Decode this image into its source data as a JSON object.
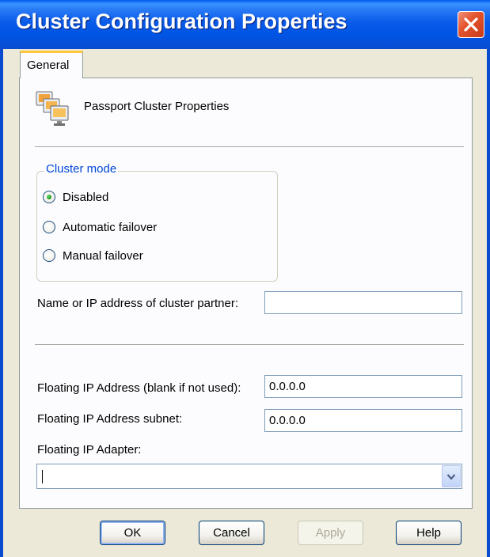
{
  "window": {
    "title": "Cluster Configuration Properties",
    "close_icon": "close-icon"
  },
  "tabs": [
    {
      "label": "General",
      "selected": true
    }
  ],
  "panel": {
    "icon": "cluster-computers-icon",
    "heading": "Passport Cluster Properties"
  },
  "cluster_mode": {
    "title": "Cluster mode",
    "options": [
      {
        "label": "Disabled",
        "checked": true
      },
      {
        "label": "Automatic failover",
        "checked": false
      },
      {
        "label": "Manual failover",
        "checked": false
      }
    ]
  },
  "fields": {
    "cluster_partner": {
      "label": "Name or IP address of cluster partner:",
      "value": ""
    },
    "floating_ip": {
      "label": "Floating IP Address (blank if not used):",
      "value": "0.0.0.0"
    },
    "floating_subnet": {
      "label": "Floating IP Address subnet:",
      "value": "0.0.0.0"
    },
    "floating_adapter": {
      "label": "Floating IP Adapter:",
      "value": ""
    }
  },
  "buttons": {
    "ok": "OK",
    "cancel": "Cancel",
    "apply": "Apply",
    "help": "Help"
  },
  "colors": {
    "titlebar": "#0055E5",
    "close_button": "#E5542F",
    "group_title": "#0046D5",
    "dialog_background": "#ECE9D8",
    "tab_highlight": "#FFC83C"
  }
}
